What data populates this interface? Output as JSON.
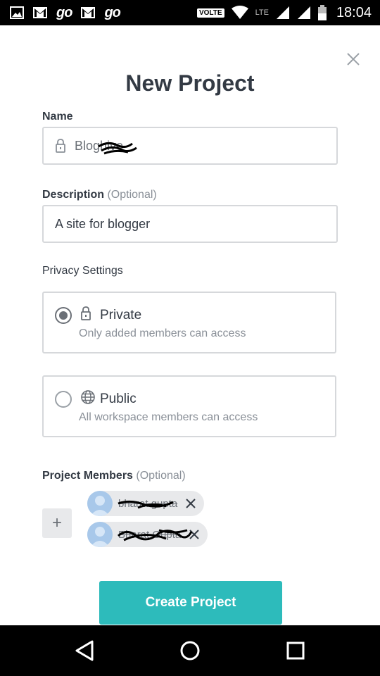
{
  "status_bar": {
    "carrier_go_1": "go",
    "carrier_go_2": "go",
    "volte": "VOLTE",
    "lte": "LTE",
    "time": "18:04"
  },
  "dialog": {
    "title": "New Project",
    "name": {
      "label": "Name",
      "value": "Bloghive"
    },
    "description": {
      "label": "Description",
      "optional": "(Optional)",
      "value": "A site for blogger"
    },
    "privacy": {
      "label": "Privacy Settings",
      "options": [
        {
          "title": "Private",
          "description": "Only added members can access",
          "selected": true,
          "icon": "lock-icon"
        },
        {
          "title": "Public",
          "description": "All workspace members can access",
          "selected": false,
          "icon": "globe-icon"
        }
      ]
    },
    "members": {
      "label": "Project Members",
      "optional": "(Optional)",
      "add_label": "+",
      "list": [
        {
          "name": "bharat gupta"
        },
        {
          "name": "Bharat Gupta"
        }
      ]
    },
    "create_button": "Create Project"
  },
  "colors": {
    "accent": "#2dbbbb",
    "text": "#333a44",
    "muted": "#8a9098",
    "border": "#d6d8db"
  }
}
